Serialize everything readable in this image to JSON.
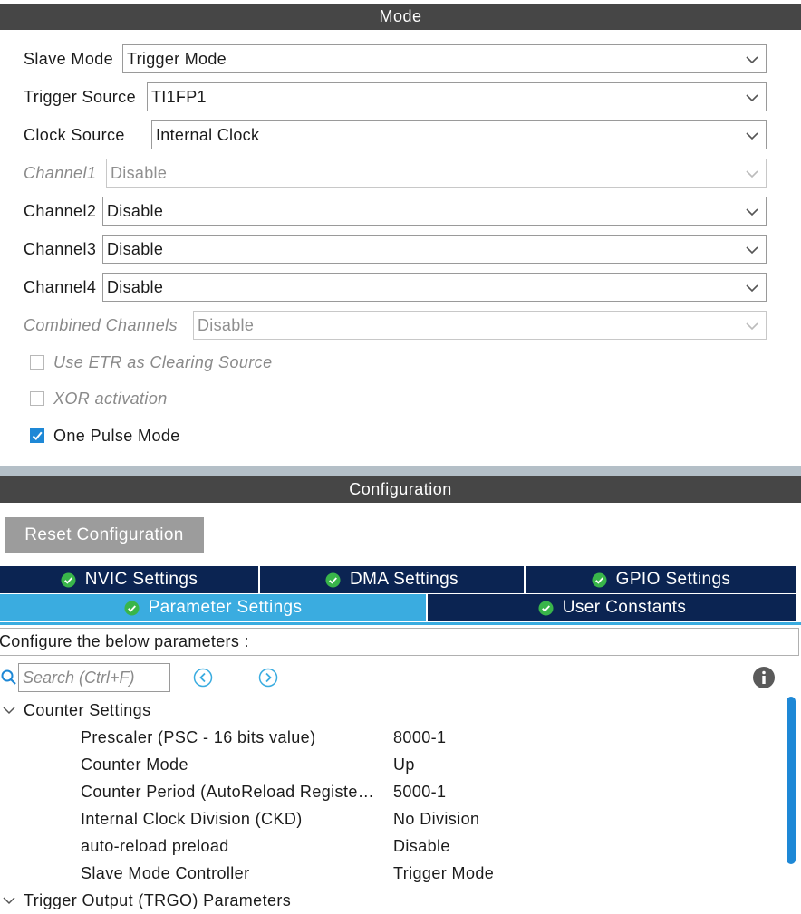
{
  "mode": {
    "header": "Mode",
    "fields": [
      {
        "label": "Slave Mode",
        "value": "Trigger Mode",
        "disabled": false
      },
      {
        "label": "Trigger Source",
        "value": "TI1FP1",
        "disabled": false
      },
      {
        "label": "Clock Source",
        "value": "Internal Clock",
        "disabled": false
      },
      {
        "label": "Channel1",
        "value": "Disable",
        "disabled": true
      },
      {
        "label": "Channel2",
        "value": "Disable",
        "disabled": false
      },
      {
        "label": "Channel3",
        "value": "Disable",
        "disabled": false
      },
      {
        "label": "Channel4",
        "value": "Disable",
        "disabled": false
      },
      {
        "label": "Combined Channels",
        "value": "Disable",
        "disabled": true
      }
    ],
    "checkboxes": [
      {
        "label": "Use ETR as Clearing Source",
        "checked": false,
        "disabled": true
      },
      {
        "label": "XOR activation",
        "checked": false,
        "disabled": true
      },
      {
        "label": "One Pulse Mode",
        "checked": true,
        "disabled": false
      }
    ]
  },
  "configuration": {
    "header": "Configuration",
    "reset_label": "Reset Configuration",
    "tabs_row1": [
      "NVIC Settings",
      "DMA Settings",
      "GPIO Settings"
    ],
    "tabs_row2": [
      "Parameter Settings",
      "User Constants"
    ],
    "active_tab": "Parameter Settings",
    "description": "Configure the below parameters :",
    "search_placeholder": "Search (Ctrl+F)",
    "groups": [
      {
        "title": "Counter Settings",
        "params": [
          {
            "name": "Prescaler (PSC - 16 bits value)",
            "value": "8000-1"
          },
          {
            "name": "Counter Mode",
            "value": "Up"
          },
          {
            "name": "Counter Period (AutoReload Registe…",
            "value": "5000-1"
          },
          {
            "name": "Internal Clock Division (CKD)",
            "value": "No Division"
          },
          {
            "name": "auto-reload preload",
            "value": "Disable"
          },
          {
            "name": "Slave Mode Controller",
            "value": "Trigger Mode"
          }
        ]
      },
      {
        "title": "Trigger Output (TRGO) Parameters",
        "params": []
      }
    ]
  },
  "colors": {
    "header_bg": "#464646",
    "tab_bg": "#0b2452",
    "tab_active_bg": "#3aace0",
    "check_accent": "#1e88d6",
    "icon_green": "#39b54a"
  }
}
